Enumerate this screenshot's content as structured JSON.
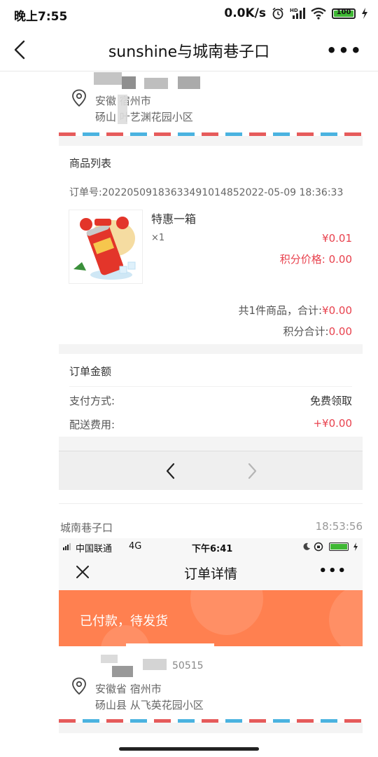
{
  "status_bar": {
    "time": "晚上7:55",
    "network_speed": "0.0K/s",
    "battery": "100",
    "icons": [
      "alarm-icon",
      "signal-icon",
      "wifi-icon",
      "battery-icon",
      "charging-icon"
    ]
  },
  "nav": {
    "title": "sunshine与城南巷子口",
    "back_icon": "chevron-left-icon",
    "more_icon": "more-dots-icon"
  },
  "order_screenshot": {
    "address": {
      "line1": "安徽     宿州市",
      "line2": "砀山     叶艺渊花园小区"
    },
    "goods_section": {
      "title": "商品列表",
      "order_label": "订单号:",
      "order_number": "20220509183633491014852022-05-09 18:36:33",
      "item_name": "特惠一箱",
      "item_qty": "×1",
      "item_price": "¥0.01",
      "points_price_label": "积分价格:",
      "points_price_value": "0.00",
      "summary_prefix": "共1件商品，合计:",
      "summary_value": "¥0.00",
      "points_total_label": "积分合计:",
      "points_total_value": "0.00"
    },
    "amount_section": {
      "title": "订单金额",
      "pay_method_label": "支付方式:",
      "pay_method_value": "免费领取",
      "delivery_label": "配送费用:",
      "delivery_value": "+¥0.00"
    }
  },
  "pager": {
    "prev_icon": "chevron-left-icon",
    "next_icon": "chevron-right-icon"
  },
  "chat": {
    "sender": "城南巷子口",
    "time": "18:53:56"
  },
  "order_screenshot_2": {
    "carrier": "中国联通",
    "network": "4G",
    "time": "下午6:41",
    "title": "订单详情",
    "status_banner": "已付款，待发货",
    "address_line1": "安徽省 宿州市",
    "address_line2": "砀山县 从飞英花园小区",
    "partial_phone": "50515"
  },
  "colors": {
    "accent_red": "#e8424e",
    "banner_orange": "#ff8050",
    "airmail_red": "#e65b5b",
    "airmail_blue": "#4ab3e0"
  }
}
